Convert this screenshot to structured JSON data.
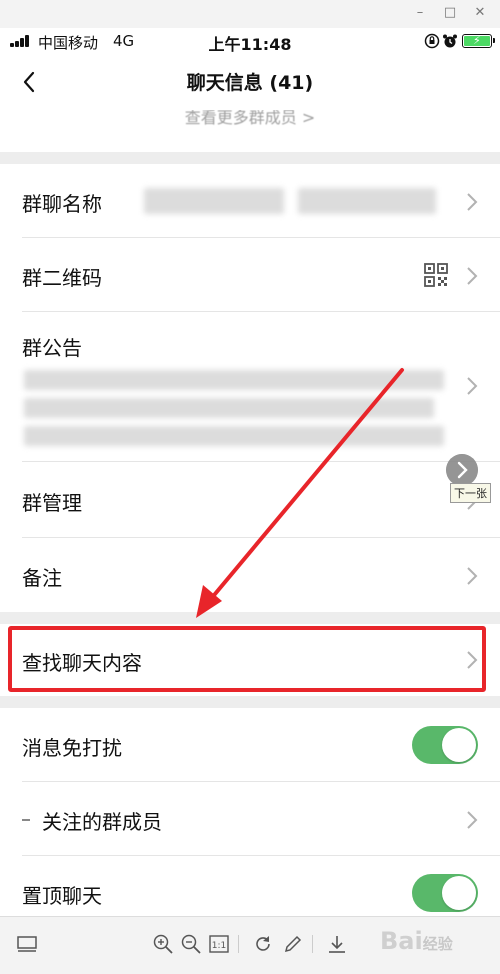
{
  "statusbar": {
    "carrier": "中国移动",
    "network": "4G",
    "time": "上午11:48"
  },
  "navbar": {
    "title": "聊天信息 (41)"
  },
  "members": {
    "more_label": "查看更多群成员 >"
  },
  "cells": {
    "group_name": "群聊名称",
    "qr_code": "群二维码",
    "announcement": "群公告",
    "manage": "群管理",
    "remark": "备注",
    "search_history": "查找聊天内容",
    "mute": "消息免打扰",
    "followed_members": "关注的群成员",
    "sticky": "置顶聊天"
  },
  "toggles": {
    "mute_on": true,
    "sticky_on": true
  },
  "viewer": {
    "next_tip": "下一张",
    "watermark_brand": "Bai",
    "watermark_suffix": "经验"
  },
  "colors": {
    "toggle_on": "#59b86a",
    "highlight": "#e8252a"
  }
}
